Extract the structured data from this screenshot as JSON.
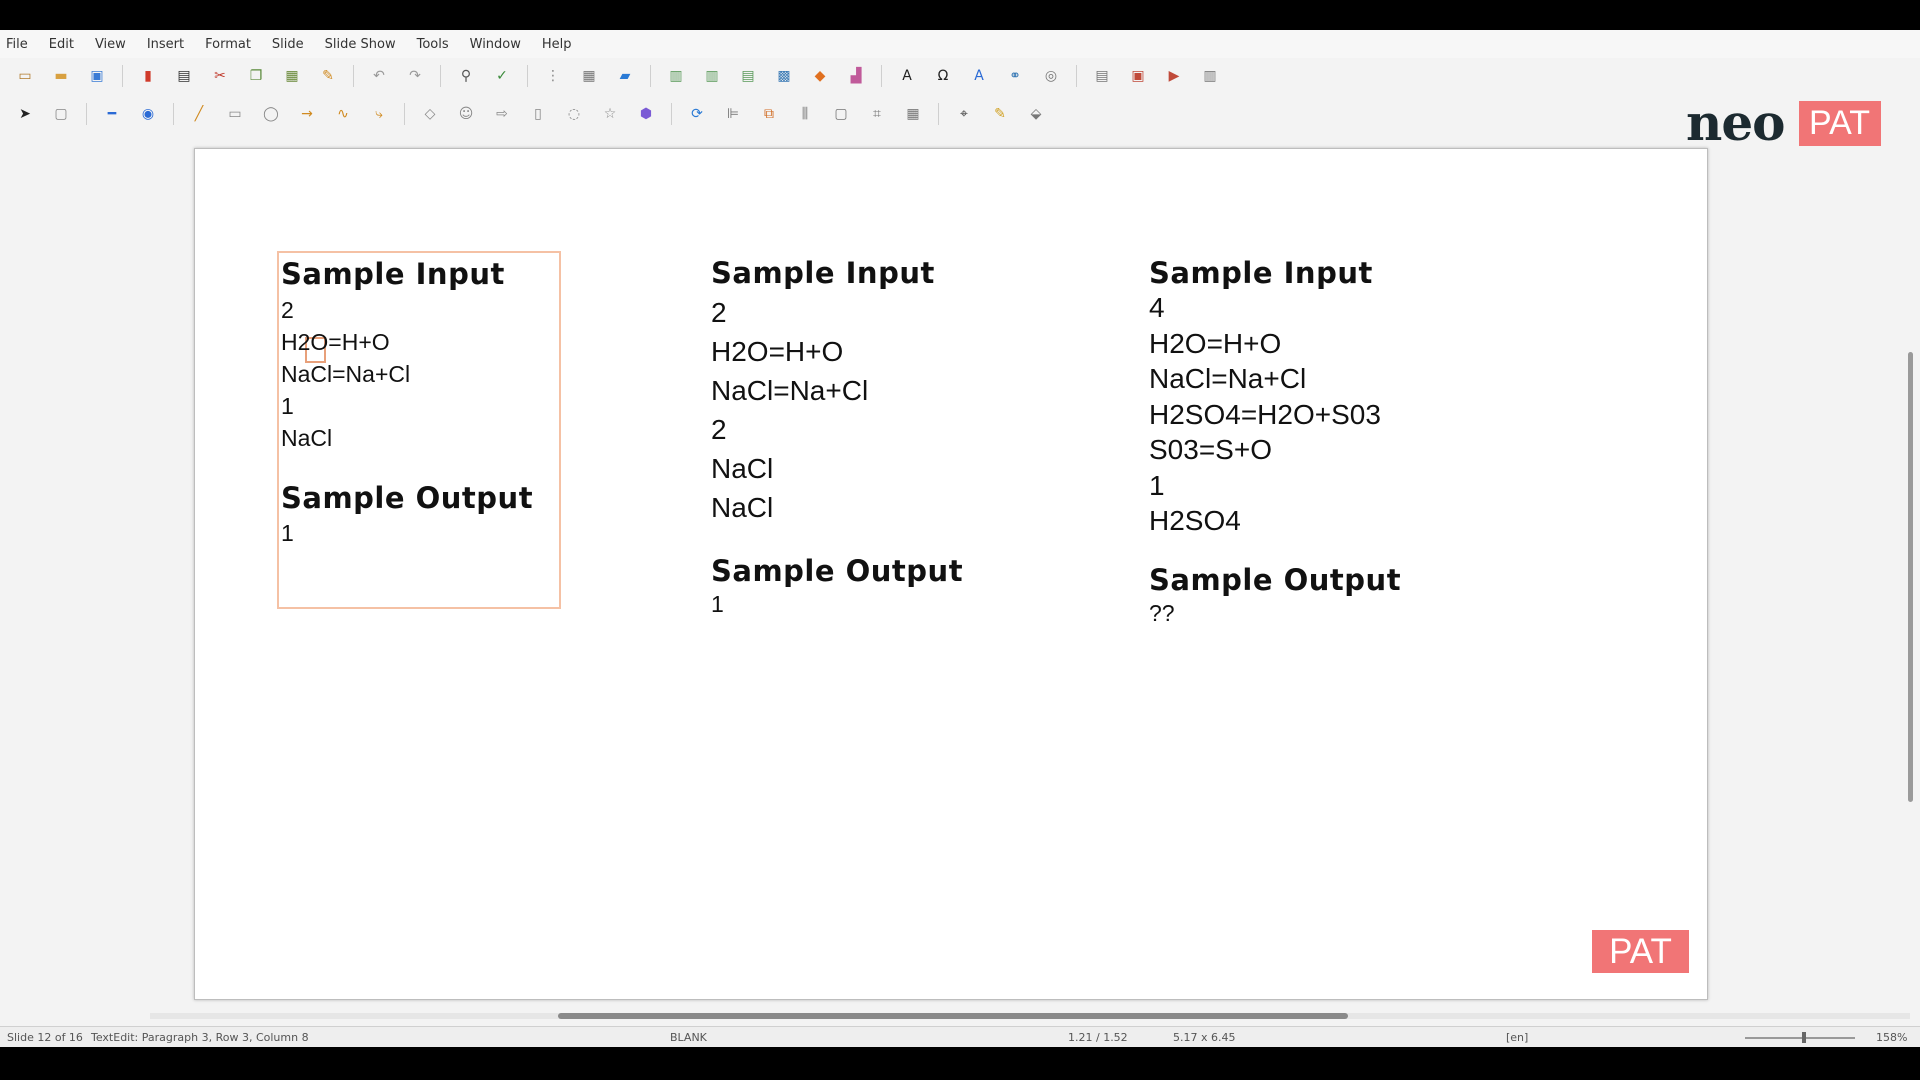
{
  "menu": [
    "File",
    "Edit",
    "View",
    "Insert",
    "Format",
    "Slide",
    "Slide Show",
    "Tools",
    "Window",
    "Help"
  ],
  "toolbar_icons": {
    "standard": [
      "new-icon",
      "open-icon",
      "save-icon",
      "export-pdf-icon",
      "print-icon",
      "cut-icon",
      "copy-icon",
      "paste-icon",
      "clone-formatting-icon",
      "undo-icon",
      "redo-icon",
      "find-replace-icon",
      "spellcheck-icon",
      "grid-icon",
      "table-icon",
      "image-icon",
      "new-slide-icon",
      "duplicate-slide-icon",
      "slide-layout-icon",
      "media-icon",
      "shapes-icon",
      "chart-icon",
      "fontwork-text-icon",
      "special-character-icon",
      "fontwork-icon",
      "hyperlink-icon",
      "draw-functions-icon",
      "display-views-icon",
      "master-slide-icon",
      "slide-show-icon",
      "sidebar-icon"
    ],
    "drawing": [
      "select-icon",
      "zoom-icon",
      "line-color-icon",
      "fill-color-icon",
      "line-icon",
      "rectangle-icon",
      "ellipse-icon",
      "arrow-icon",
      "curve-icon",
      "connector-icon",
      "basic-shapes-icon",
      "symbol-shapes-icon",
      "block-arrows-icon",
      "flowchart-icon",
      "callouts-icon",
      "stars-icon",
      "3d-objects-icon",
      "rotate-icon",
      "align-icon",
      "arrange-icon",
      "distribute-icon",
      "shadow-icon",
      "crop-icon",
      "filter-icon",
      "points-icon",
      "glue-points-icon",
      "toggle-extrusion-icon"
    ]
  },
  "logo": {
    "neo": "neo",
    "pat": "PAT"
  },
  "slide": {
    "columns": [
      {
        "input_heading": "Sample Input",
        "input_lines": [
          "2",
          "H2O=H+O",
          "NaCl=Na+Cl",
          "1",
          "NaCl"
        ],
        "output_heading": "Sample Output",
        "output_lines": [
          "1"
        ]
      },
      {
        "input_heading": "Sample Input",
        "input_lines": [
          "2",
          "H2O=H+O",
          "NaCl=Na+Cl",
          "2",
          "NaCl",
          "NaCl"
        ],
        "output_heading": "Sample Output",
        "output_lines": [
          "1"
        ]
      },
      {
        "input_heading": "Sample Input",
        "input_lines": [
          "4",
          "H2O=H+O",
          "NaCl=Na+Cl",
          "H2SO4=H2O+S03",
          "S03=S+O",
          "1",
          "H2SO4"
        ],
        "output_heading": "Sample Output",
        "output_lines": [
          "??"
        ]
      }
    ],
    "watermark": "PAT"
  },
  "status": {
    "slide": "Slide 12 of 16",
    "edit": "TextEdit: Paragraph 3, Row 3, Column 8",
    "layout": "BLANK",
    "position": "1.21 / 1.52",
    "size": "5.17 x 6.45",
    "language": "[en]",
    "zoom": "158%"
  },
  "colors": {
    "accent_pink": "#f17576",
    "selection_border": "#f5c1a4"
  }
}
